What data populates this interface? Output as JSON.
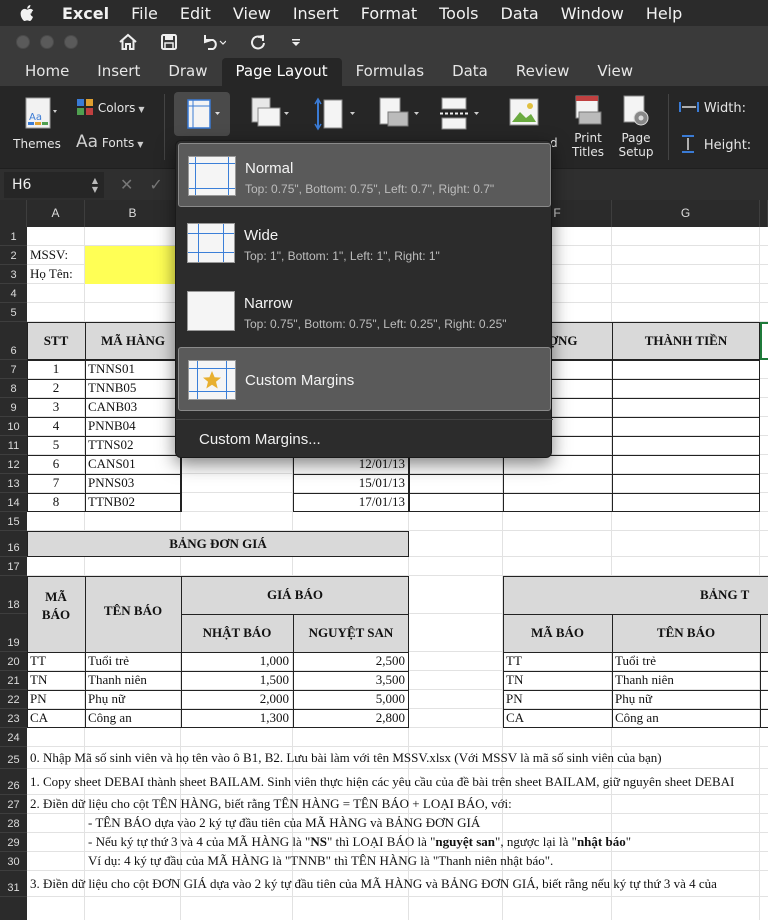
{
  "menubar": {
    "items": [
      "Excel",
      "File",
      "Edit",
      "View",
      "Insert",
      "Format",
      "Tools",
      "Data",
      "Window",
      "Help"
    ]
  },
  "tabs": [
    "Home",
    "Insert",
    "Draw",
    "Page Layout",
    "Formulas",
    "Data",
    "Review",
    "View"
  ],
  "active_tab": "Page Layout",
  "ribbon": {
    "themes_label": "Themes",
    "colors_label": "Colors",
    "fonts_label": "Fonts",
    "print_titles_1": "Print",
    "print_titles_2": "Titles",
    "page_setup_1": "Page",
    "page_setup_2": "Setup",
    "partial_label": "d",
    "width_label": "Width:",
    "height_label": "Height:"
  },
  "formula_bar": {
    "name_box": "H6"
  },
  "margins_menu": {
    "items": [
      {
        "title": "Normal",
        "subtitle": "Top: 0.75\", Bottom: 0.75\", Left: 0.7\", Right: 0.7\""
      },
      {
        "title": "Wide",
        "subtitle": "Top: 1\", Bottom: 1\", Left: 1\", Right: 1\""
      },
      {
        "title": "Narrow",
        "subtitle": "Top: 0.75\", Bottom: 0.75\", Left: 0.25\", Right: 0.25\""
      },
      {
        "title": "Custom Margins",
        "subtitle": ""
      }
    ],
    "custom_link": "Custom Margins..."
  },
  "grid": {
    "columns": [
      "A",
      "B",
      "C",
      "D",
      "E",
      "F",
      "G"
    ],
    "rows": [
      "1",
      "2",
      "3",
      "4",
      "5",
      "6",
      "7",
      "8",
      "9",
      "10",
      "11",
      "12",
      "13",
      "14",
      "15",
      "16",
      "17",
      "18",
      "19",
      "20",
      "21",
      "22",
      "23",
      "24",
      "25",
      "26",
      "27",
      "28",
      "29",
      "30",
      "31"
    ],
    "mssv_label": "MSSV:",
    "ho_ten_label": "Họ Tên:",
    "header_stt": "STT",
    "header_ma_hang": "MÃ HÀNG",
    "header_luong_partial": "ƯỢNG",
    "header_thanh_tien": "THÀNH TIỀN",
    "main_rows": [
      {
        "stt": "1",
        "ma": "TNNS01",
        "date": ""
      },
      {
        "stt": "2",
        "ma": "TNNB05",
        "date": ""
      },
      {
        "stt": "3",
        "ma": "CANB03",
        "date": ""
      },
      {
        "stt": "4",
        "ma": "PNNB04",
        "date": ""
      },
      {
        "stt": "5",
        "ma": "TTNS02",
        "date": ""
      },
      {
        "stt": "6",
        "ma": "CANS01",
        "date": "12/01/13"
      },
      {
        "stt": "7",
        "ma": "PNNS03",
        "date": "15/01/13"
      },
      {
        "stt": "8",
        "ma": "TTNB02",
        "date": "17/01/13"
      }
    ],
    "bang_don_gia": "BẢNG ĐƠN GIÁ",
    "ma_bao": [
      "MÃ",
      "BÁO"
    ],
    "ten_bao": "TÊN BÁO",
    "gia_bao": "GIÁ BÁO",
    "nhat_bao": "NHẬT BÁO",
    "nguyet_san": "NGUYỆT SAN",
    "price_rows": [
      {
        "ma": "TT",
        "ten": "Tuổi trẻ",
        "nhat": "1,000",
        "nguyet": "2,500"
      },
      {
        "ma": "TN",
        "ten": "Thanh niên",
        "nhat": "1,500",
        "nguyet": "3,500"
      },
      {
        "ma": "PN",
        "ten": "Phụ nữ",
        "nhat": "2,000",
        "nguyet": "5,000"
      },
      {
        "ma": "CA",
        "ten": "Công an",
        "nhat": "1,300",
        "nguyet": "2,800"
      }
    ],
    "bang_t_partial": "BẢNG T",
    "right_ma_bao": "MÃ BÁO",
    "right_ten_bao": "TÊN BÁO",
    "right_rows": [
      {
        "ma": "TT",
        "ten": "Tuổi trẻ"
      },
      {
        "ma": "TN",
        "ten": "Thanh niên"
      },
      {
        "ma": "PN",
        "ten": "Phụ nữ"
      },
      {
        "ma": "CA",
        "ten": "Công an"
      }
    ],
    "note25": "0. Nhập Mã số sinh viên và họ tên vào ô B1, B2. Lưu bài làm với tên MSSV.xlsx  (Với MSSV là mã số sinh viên của bạn)",
    "note26": "1. Copy sheet DEBAI thành sheet BAILAM. Sinh viên thực hiện các yêu cầu của đề bài trên sheet BAILAM, giữ nguyên sheet DEBAI",
    "note27": "2. Điền dữ liệu cho cột TÊN HÀNG, biết rằng TÊN HÀNG = TÊN BÁO + LOẠI BÁO, với:",
    "note28": "- TÊN BÁO dựa vào 2 ký tự đầu tiên của MÃ HÀNG và BẢNG ĐƠN GIÁ",
    "note29_a": "- Nếu ký tự thứ 3 và 4 của MÃ HÀNG là \"",
    "note29_b": "NS",
    "note29_c": "\" thì LOẠI BÁO là \"",
    "note29_d": "nguyệt san",
    "note29_e": "\", ngược lại là \"",
    "note29_f": "nhật báo",
    "note29_g": "\"",
    "note30": "Ví dụ: 4 ký tự đầu của MÃ HÀNG là \"TNNB\" thì TÊN HÀNG là \"Thanh niên nhật báo\".",
    "note31": "3. Điền dữ liệu cho cột ĐƠN GIÁ dựa vào 2 ký tự đầu tiên của MÃ HÀNG và BẢNG ĐƠN GIÁ, biết rằng nếu  ký tự thứ 3 và 4 của"
  }
}
